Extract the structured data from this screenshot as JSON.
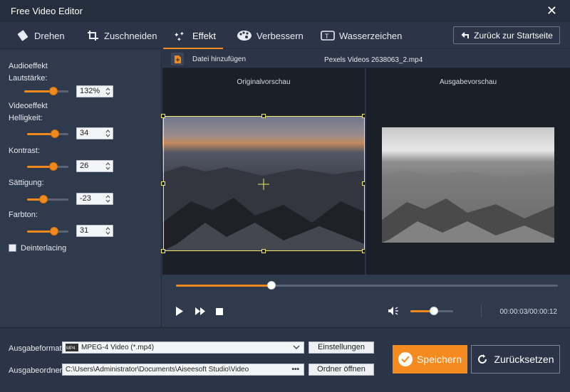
{
  "window": {
    "title": "Free Video Editor",
    "close_icon": "close-icon"
  },
  "toolbar": {
    "tabs": [
      {
        "label": "Drehen",
        "icon": "rotate-icon"
      },
      {
        "label": "Zuschneiden",
        "icon": "crop-icon"
      },
      {
        "label": "Effekt",
        "icon": "effect-icon"
      },
      {
        "label": "Verbessern",
        "icon": "palette-icon"
      },
      {
        "label": "Wasserzeichen",
        "icon": "watermark-icon"
      }
    ],
    "active_tab": "Effekt",
    "back_button": "Zurück zur Startseite"
  },
  "effects": {
    "audio_heading": "Audioeffekt",
    "volume_label": "Lautstärke:",
    "volume_value": "132%",
    "volume_level": 0.66,
    "video_heading": "Videoeffekt",
    "brightness_label": "Helligkeit:",
    "brightness_value": "34",
    "brightness_level": 0.67,
    "contrast_label": "Kontrast:",
    "contrast_value": "26",
    "contrast_level": 0.63,
    "saturation_label": "Sättigung:",
    "saturation_value": "-23",
    "saturation_level": 0.39,
    "hue_label": "Farbton:",
    "hue_value": "31",
    "hue_level": 0.65,
    "deinterlace_label": "Deinterlacing",
    "deinterlace_checked": false
  },
  "preview": {
    "add_file_label": "Datei hinzufügen",
    "file_name": "Pexels Videos 2638063_2.mp4",
    "original_label": "Originalvorschau",
    "output_label": "Ausgabevorschau"
  },
  "player": {
    "progress": 0.25,
    "volume": 0.55,
    "time": "00:00:03/00:00:12"
  },
  "output": {
    "format_label": "Ausgabeformat:",
    "format_value": "MPEG-4 Video (*.mp4)",
    "settings_button": "Einstellungen",
    "folder_label": "Ausgabeordner:",
    "folder_value": "C:\\Users\\Administrator\\Documents\\Aiseesoft Studio\\Video",
    "open_folder_button": "Ordner öffnen",
    "save_button": "Speichern",
    "reset_button": "Zurücksetzen"
  },
  "colors": {
    "accent": "#f58a1f",
    "bg": "#2f3a4d",
    "crop_frame": "#f2e86a"
  }
}
